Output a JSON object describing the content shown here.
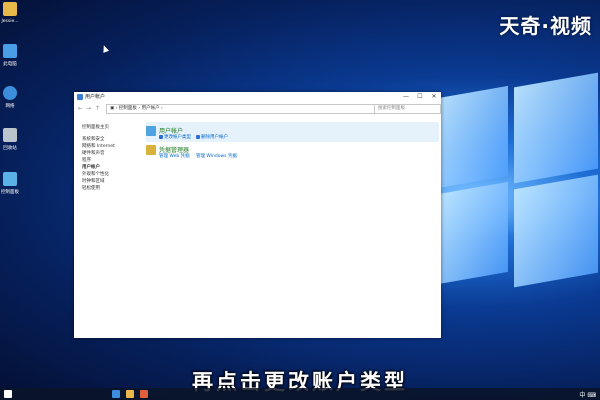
{
  "watermark": "天奇·视频",
  "subtitle": "再点击更改账户类型",
  "desktop_icons": [
    {
      "label": "Jessie...",
      "icon": "folder-user-icon",
      "color": "#e8b84a"
    },
    {
      "label": "此电脑",
      "icon": "computer-icon",
      "color": "#4a9ee8"
    },
    {
      "label": "网络",
      "icon": "network-icon",
      "color": "#3c8ddc"
    },
    {
      "label": "回收站",
      "icon": "recycle-bin-icon",
      "color": "#b9c4cc"
    },
    {
      "label": "控制面板",
      "icon": "control-panel-icon",
      "color": "#5cb0e8"
    }
  ],
  "window": {
    "title": "用户帐户",
    "controls": {
      "minimize": "—",
      "maximize": "☐",
      "close": "✕"
    },
    "address": "▣ › 控制面板 › 用户帐户 ›",
    "search_placeholder": "搜索控制面板",
    "sidebar": [
      {
        "label": "控制面板主页",
        "active": false
      },
      {
        "label": "系统和安全",
        "active": false
      },
      {
        "label": "网络和 Internet",
        "active": false
      },
      {
        "label": "硬件和声音",
        "active": false
      },
      {
        "label": "程序",
        "active": false
      },
      {
        "label": "用户帐户",
        "active": true
      },
      {
        "label": "外观和个性化",
        "active": false
      },
      {
        "label": "时钟和区域",
        "active": false
      },
      {
        "label": "轻松使用",
        "active": false
      }
    ],
    "categories": [
      {
        "title": "用户帐户",
        "icon_color": "#4fa3e0",
        "links": [
          "更改帐户类型",
          "删除用户帐户"
        ]
      },
      {
        "title": "凭据管理器",
        "icon_color": "#d9b23c",
        "links": [
          "管理 Web 凭据",
          "管理 Windows 凭据"
        ]
      }
    ]
  },
  "taskbar": {
    "tray_text": "中 ⌨"
  }
}
